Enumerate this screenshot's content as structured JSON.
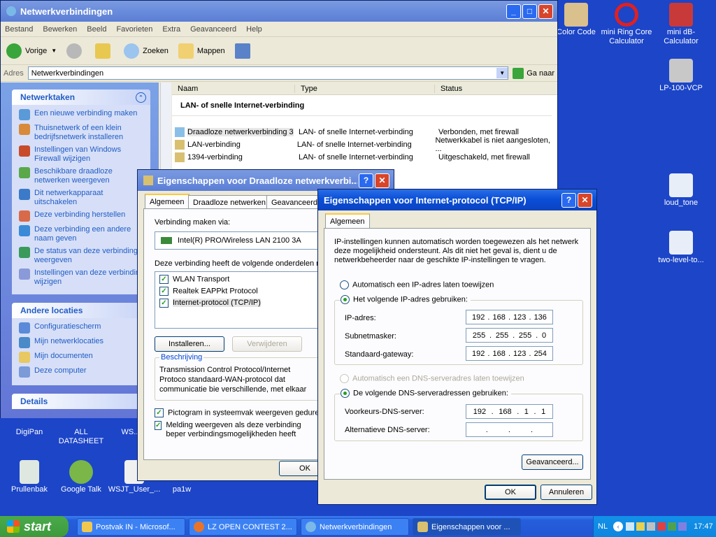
{
  "desktop": {
    "icons_right": [
      {
        "label": "Color Code"
      },
      {
        "label": "mini Ring Core Calculator"
      },
      {
        "label": "mini dB-Calculator"
      },
      {
        "label": "LP-100-VCP"
      },
      {
        "label": "loud_tone"
      },
      {
        "label": "two-level-to..."
      }
    ],
    "icons_bottom": [
      {
        "label": "DigiPan"
      },
      {
        "label": "ALL DATASHEET"
      },
      {
        "label": "WS..."
      },
      {
        "label": "Prullenbak"
      },
      {
        "label": "Google Talk"
      },
      {
        "label": "WSJT_User_..."
      },
      {
        "label": "pa1w"
      }
    ]
  },
  "explorer": {
    "title": "Netwerkverbindingen",
    "menu": [
      "Bestand",
      "Bewerken",
      "Beeld",
      "Favorieten",
      "Extra",
      "Geavanceerd",
      "Help"
    ],
    "toolbar": {
      "back": "Vorige",
      "search": "Zoeken",
      "folders": "Mappen"
    },
    "address_label": "Adres",
    "address_value": "Netwerkverbindingen",
    "go_label": "Ga naar",
    "tasks_title": "Netwerktaken",
    "tasks": [
      "Een nieuwe verbinding maken",
      "Thuisnetwerk of een klein bedrijfsnetwerk installeren",
      "Instellingen van Windows Firewall wijzigen",
      "Beschikbare draadloze netwerken weergeven",
      "Dit netwerkapparaat uitschakelen",
      "Deze verbinding herstellen",
      "Deze verbinding een andere naam geven",
      "De status van deze verbinding weergeven",
      "Instellingen van deze verbinding wijzigen"
    ],
    "other_title": "Andere locaties",
    "other": [
      "Configuratiescherm",
      "Mijn netwerklocaties",
      "Mijn documenten",
      "Deze computer"
    ],
    "details_title": "Details",
    "columns": {
      "name": "Naam",
      "type": "Type",
      "status": "Status"
    },
    "group": "LAN- of snelle Internet-verbinding",
    "rows": [
      {
        "name": "Draadloze netwerkverbinding 3",
        "type": "LAN- of snelle Internet-verbinding",
        "status": "Verbonden, met firewall"
      },
      {
        "name": "LAN-verbinding",
        "type": "LAN- of snelle Internet-verbinding",
        "status": "Netwerkkabel is niet aangesloten, ..."
      },
      {
        "name": "1394-verbinding",
        "type": "LAN- of snelle Internet-verbinding",
        "status": "Uitgeschakeld, met firewall"
      }
    ]
  },
  "props": {
    "title": "Eigenschappen voor Draadloze netwerkverbi...",
    "tabs": [
      "Algemeen",
      "Draadloze netwerken",
      "Geavanceerd"
    ],
    "connect_label": "Verbinding maken via:",
    "adapter": "Intel(R) PRO/Wireless LAN 2100 3A",
    "components_label": "Deze verbinding heeft de volgende onderdelen no",
    "components": [
      "WLAN Transport",
      "Realtek EAPPkt Protocol",
      "Internet-protocol (TCP/IP)"
    ],
    "install": "Installeren...",
    "remove": "Verwijderen",
    "desc_title": "Beschrijving",
    "desc_text": "Transmission Control Protocol/Internet Protoco standaard-WAN-protocol dat communicatie bie verschillende, met elkaar verbonden netwerker",
    "opt1": "Pictogram in systeemvak weergeven gedurend",
    "opt2": "Melding weergeven als deze verbinding beper verbindingsmogelijkheden heeft",
    "ok": "OK"
  },
  "tcpip": {
    "title": "Eigenschappen voor Internet-protocol (TCP/IP)",
    "tab": "Algemeen",
    "intro": "IP-instellingen kunnen automatisch worden toegewezen als het netwerk deze mogelijkheid ondersteunt. Als dit niet het geval is, dient u de netwerkbeheerder naar de geschikte IP-instellingen te vragen.",
    "auto_ip": "Automatisch een IP-adres laten toewijzen",
    "manual_ip": "Het volgende IP-adres gebruiken:",
    "ip_label": "IP-adres:",
    "ip": [
      "192",
      "168",
      "123",
      "136"
    ],
    "mask_label": "Subnetmasker:",
    "mask": [
      "255",
      "255",
      "255",
      "0"
    ],
    "gw_label": "Standaard-gateway:",
    "gw": [
      "192",
      "168",
      "123",
      "254"
    ],
    "auto_dns": "Automatisch een DNS-serveradres laten toewijzen",
    "manual_dns": "De volgende DNS-serveradressen gebruiken:",
    "dns1_label": "Voorkeurs-DNS-server:",
    "dns1": [
      "192",
      "168",
      "1",
      "1"
    ],
    "dns2_label": "Alternatieve DNS-server:",
    "advanced": "Geavanceerd...",
    "ok": "OK",
    "cancel": "Annuleren"
  },
  "taskbar": {
    "start": "start",
    "items": [
      "Postvak IN - Microsof...",
      "LZ OPEN CONTEST 2...",
      "Netwerkverbindingen",
      "Eigenschappen voor ..."
    ],
    "lang": "NL",
    "clock": "17:47"
  },
  "colors": {
    "desktop": "#1c45c8",
    "taskbar": "#245edb",
    "start": "#3c9a3c"
  }
}
